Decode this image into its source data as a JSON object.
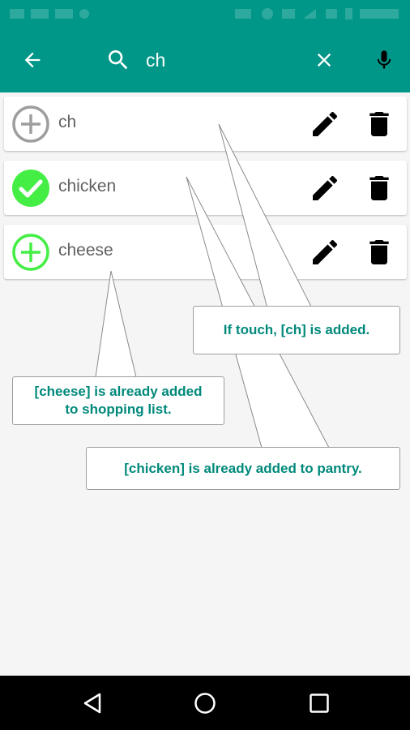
{
  "search": {
    "query": "ch"
  },
  "items": [
    {
      "label": "ch",
      "status": "not-added"
    },
    {
      "label": "chicken",
      "status": "in-pantry"
    },
    {
      "label": "cheese",
      "status": "in-shopping-list"
    }
  ],
  "callouts": {
    "touch_add": "If touch, [ch] is added.",
    "cheese_line1": "[cheese] is already added",
    "cheese_line2": "to shopping list.",
    "chicken": "[chicken] is already added to pantry."
  },
  "colors": {
    "primary": "#009688",
    "added_green": "#44ee44",
    "callout_text": "#00897b",
    "neutral_gray": "#9e9e9e"
  },
  "icons": {
    "back": "arrow-back-icon",
    "search": "search-icon",
    "clear": "close-icon",
    "voice": "microphone-icon",
    "edit": "pencil-icon",
    "delete": "trash-icon",
    "add": "plus-circle-icon",
    "added": "check-circle-icon"
  }
}
